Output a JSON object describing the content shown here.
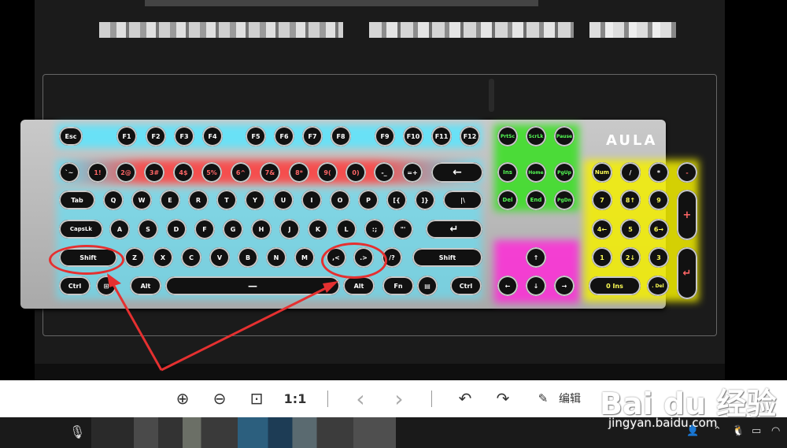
{
  "keyboard": {
    "brand_logo": "AULA",
    "function_row": [
      "Esc",
      "F1",
      "F2",
      "F3",
      "F4",
      "F5",
      "F6",
      "F7",
      "F8",
      "F9",
      "F10",
      "F11",
      "F12",
      "PrtSc",
      "ScrLk",
      "Pause"
    ],
    "number_row": [
      "`~",
      "1!",
      "2@",
      "3#",
      "4$",
      "5%",
      "6^",
      "7&",
      "8*",
      "9(",
      "0)",
      "-_",
      "=+",
      "←"
    ],
    "nav_row1": [
      "Ins",
      "Home",
      "PgUp"
    ],
    "nav_row2": [
      "Del",
      "End",
      "PgDn"
    ],
    "numpad_row1": [
      "Num",
      "/",
      "*",
      "-"
    ],
    "numpad_row2": [
      "7",
      "8↑",
      "9"
    ],
    "numpad_row3": [
      "4←",
      "5",
      "6→"
    ],
    "numpad_row4": [
      "1",
      "2↓",
      "3"
    ],
    "numpad_plus": "+",
    "numpad_enter": "↵",
    "tab_row": [
      "Tab",
      "Q",
      "W",
      "E",
      "R",
      "T",
      "Y",
      "U",
      "I",
      "O",
      "P",
      "[{",
      "]}",
      "|\\"
    ],
    "caps_row": [
      "CapsLk",
      "A",
      "S",
      "D",
      "F",
      "G",
      "H",
      "J",
      "K",
      "L",
      ":;",
      "\"'",
      "↵"
    ],
    "shift_row": [
      "Shift",
      "Z",
      "X",
      "C",
      "V",
      "B",
      "N",
      "M",
      ",<",
      ".>",
      "/?",
      "Shift"
    ],
    "ctrl_row": [
      "Ctrl",
      "⊞",
      "Alt",
      "—",
      "Alt",
      "Fn",
      "▤",
      "Ctrl"
    ],
    "arrows": [
      "↑",
      "←",
      "↓",
      "→"
    ],
    "numpad_bottom": [
      "0 Ins",
      ". Del"
    ]
  },
  "viewer_toolbar": {
    "zoom_in": "⊕",
    "zoom_out": "⊖",
    "fit": "⊡",
    "actual_size": "1:1",
    "prev": "‹",
    "next": "›",
    "rotate_left": "↶",
    "rotate_right": "↷",
    "edit_label": "编辑"
  },
  "watermark": {
    "brand": "Bai du 经验",
    "url": "jingyan.baidu.com"
  },
  "colors": {
    "cyan_glow": "#59e6ff",
    "red_glow": "#ff3b3b",
    "green_glow": "#37e020",
    "yellow_glow": "#f5f000",
    "magenta_glow": "#ff2bd8",
    "annotation_red": "#e53030"
  }
}
